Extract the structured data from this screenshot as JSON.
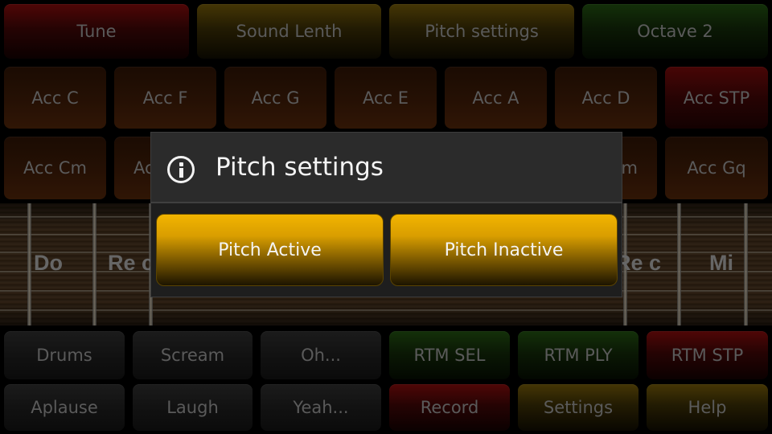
{
  "top_row": [
    {
      "label": "Tune",
      "color": "red"
    },
    {
      "label": "Sound Lenth",
      "color": "gold"
    },
    {
      "label": "Pitch settings",
      "color": "gold"
    },
    {
      "label": "Octave 2",
      "color": "green"
    }
  ],
  "acc_row1": [
    {
      "label": "Acc C",
      "color": "brown"
    },
    {
      "label": "Acc F",
      "color": "brown"
    },
    {
      "label": "Acc G",
      "color": "brown"
    },
    {
      "label": "Acc E",
      "color": "brown"
    },
    {
      "label": "Acc A",
      "color": "brown"
    },
    {
      "label": "Acc D",
      "color": "brown"
    },
    {
      "label": "Acc STP",
      "color": "red"
    }
  ],
  "acc_row2": [
    {
      "label": "Acc Cm"
    },
    {
      "label": "Ac"
    },
    {
      "label": ""
    },
    {
      "label": ""
    },
    {
      "label": ""
    },
    {
      "label": "m"
    },
    {
      "label": "Acc Gq"
    }
  ],
  "fretboard": {
    "notes": [
      "Do",
      "Re c",
      "Re c",
      "Mi"
    ]
  },
  "bottom_row1": [
    {
      "label": "Drums",
      "color": "dark"
    },
    {
      "label": "Scream",
      "color": "dark"
    },
    {
      "label": "Oh...",
      "color": "dark"
    },
    {
      "label": "RTM SEL",
      "color": "green"
    },
    {
      "label": "RTM PLY",
      "color": "green"
    },
    {
      "label": "RTM STP",
      "color": "red"
    }
  ],
  "bottom_row2": [
    {
      "label": "Aplause",
      "color": "dark"
    },
    {
      "label": "Laugh",
      "color": "dark"
    },
    {
      "label": "Yeah...",
      "color": "dark"
    },
    {
      "label": "Record",
      "color": "red"
    },
    {
      "label": "Settings",
      "color": "gold"
    },
    {
      "label": "Help",
      "color": "gold"
    }
  ],
  "dialog": {
    "title": "Pitch settings",
    "icon": "info-icon",
    "buttons": [
      "Pitch Active",
      "Pitch Inactive"
    ],
    "accent": "#f2b400"
  }
}
